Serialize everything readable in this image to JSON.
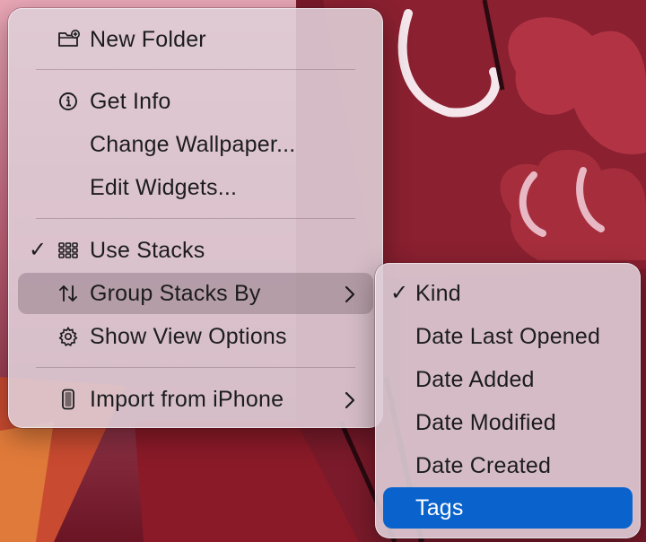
{
  "context_menu": {
    "items": [
      {
        "label": "New Folder",
        "icon": "folder-plus-icon"
      },
      {
        "label": "Get Info",
        "icon": "info-circle-icon"
      },
      {
        "label": "Change Wallpaper..."
      },
      {
        "label": "Edit Widgets..."
      },
      {
        "label": "Use Stacks",
        "icon": "stacks-grid-icon",
        "checked": true
      },
      {
        "label": "Group Stacks By",
        "icon": "sort-arrows-icon",
        "has_submenu": true,
        "highlighted": true
      },
      {
        "label": "Show View Options",
        "icon": "gear-icon"
      },
      {
        "label": "Import from iPhone",
        "icon": "iphone-icon",
        "has_submenu": true
      }
    ],
    "check_glyph": "✓"
  },
  "submenu": {
    "items": [
      {
        "label": "Kind",
        "checked": true
      },
      {
        "label": "Date Last Opened"
      },
      {
        "label": "Date Added"
      },
      {
        "label": "Date Modified"
      },
      {
        "label": "Date Created"
      },
      {
        "label": "Tags",
        "selected": true
      }
    ],
    "check_glyph": "✓"
  },
  "colors": {
    "menu_background": "#decdd6",
    "highlight": "#96808a",
    "selection": "#0a63cc",
    "wallpaper_red": "#7a1a2a"
  }
}
